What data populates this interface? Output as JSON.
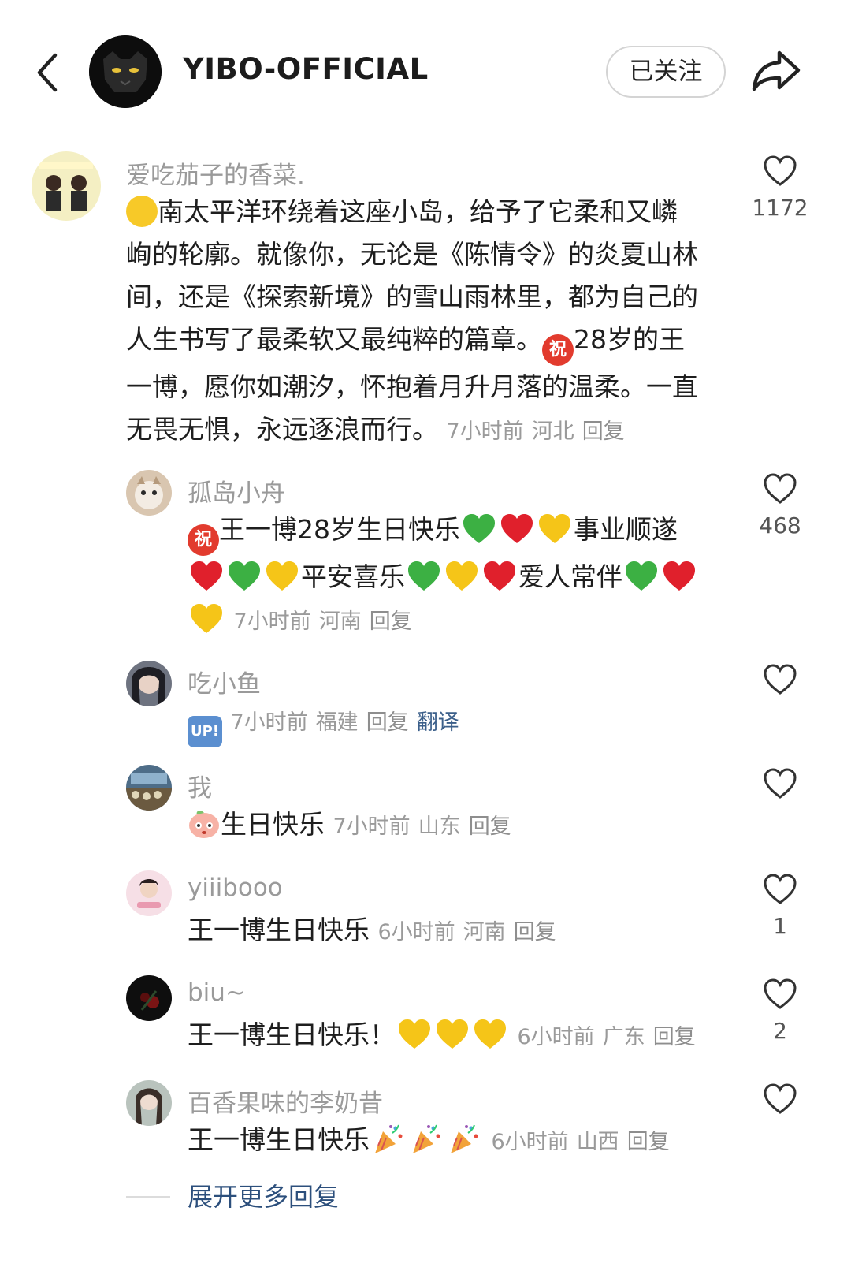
{
  "header": {
    "back_icon": "chevron-left-icon",
    "account_name": "YIBO-OFFICIAL",
    "follow_label": "已关注",
    "share_icon": "share-arrow-icon"
  },
  "comments": [
    {
      "user": "爱吃茄子的香菜.",
      "line1": "南太平洋环绕着这座小岛，给予了它柔和又嶙",
      "line2": "峋的轮廓。就像你，无论是《陈情令》的炎夏山林",
      "line3": "间，还是《探索新境》的雪山雨林里，都为自己的",
      "line4a": "人生书写了最柔软又最纯粹的篇章。",
      "line4b": "28岁的王",
      "line5": "一博，愿你如潮汐，怀抱着月升月落的温柔。一直",
      "line6": "无畏无惧，永远逐浪而行。",
      "time": "7小时前",
      "location": "河北",
      "reply": "回复",
      "likes": "1172"
    },
    {
      "user": "孤岛小舟",
      "text1": "王一博28岁生日快乐",
      "text2": "事业顺遂",
      "text3": "平安喜乐",
      "text4": "爱人常伴",
      "time": "7小时前",
      "location": "河南",
      "reply": "回复",
      "likes": "468"
    },
    {
      "user": "吃小鱼",
      "up_badge": "UP!",
      "time": "7小时前",
      "location": "福建",
      "reply": "回复",
      "translate": "翻译"
    },
    {
      "user": "我",
      "text": "生日快乐",
      "time": "7小时前",
      "location": "山东",
      "reply": "回复"
    },
    {
      "user": "yiiibooo",
      "text": "王一博生日快乐",
      "time": "6小时前",
      "location": "河南",
      "reply": "回复",
      "likes": "1"
    },
    {
      "user": "biu~",
      "text": "王一博生日快乐！",
      "time": "6小时前",
      "location": "广东",
      "reply": "回复",
      "likes": "2"
    },
    {
      "user": "百香果味的李奶昔",
      "text": "王一博生日快乐",
      "time": "6小时前",
      "location": "山西",
      "reply": "回复"
    }
  ],
  "expand_replies": "展开更多回复",
  "zhu_emoji": "祝",
  "colors": {
    "username": "#9a9a9a",
    "link_blue": "#2c4f7c",
    "heart_red": "#e0202c",
    "heart_green": "#3cb043",
    "heart_yellow": "#f5c518"
  }
}
